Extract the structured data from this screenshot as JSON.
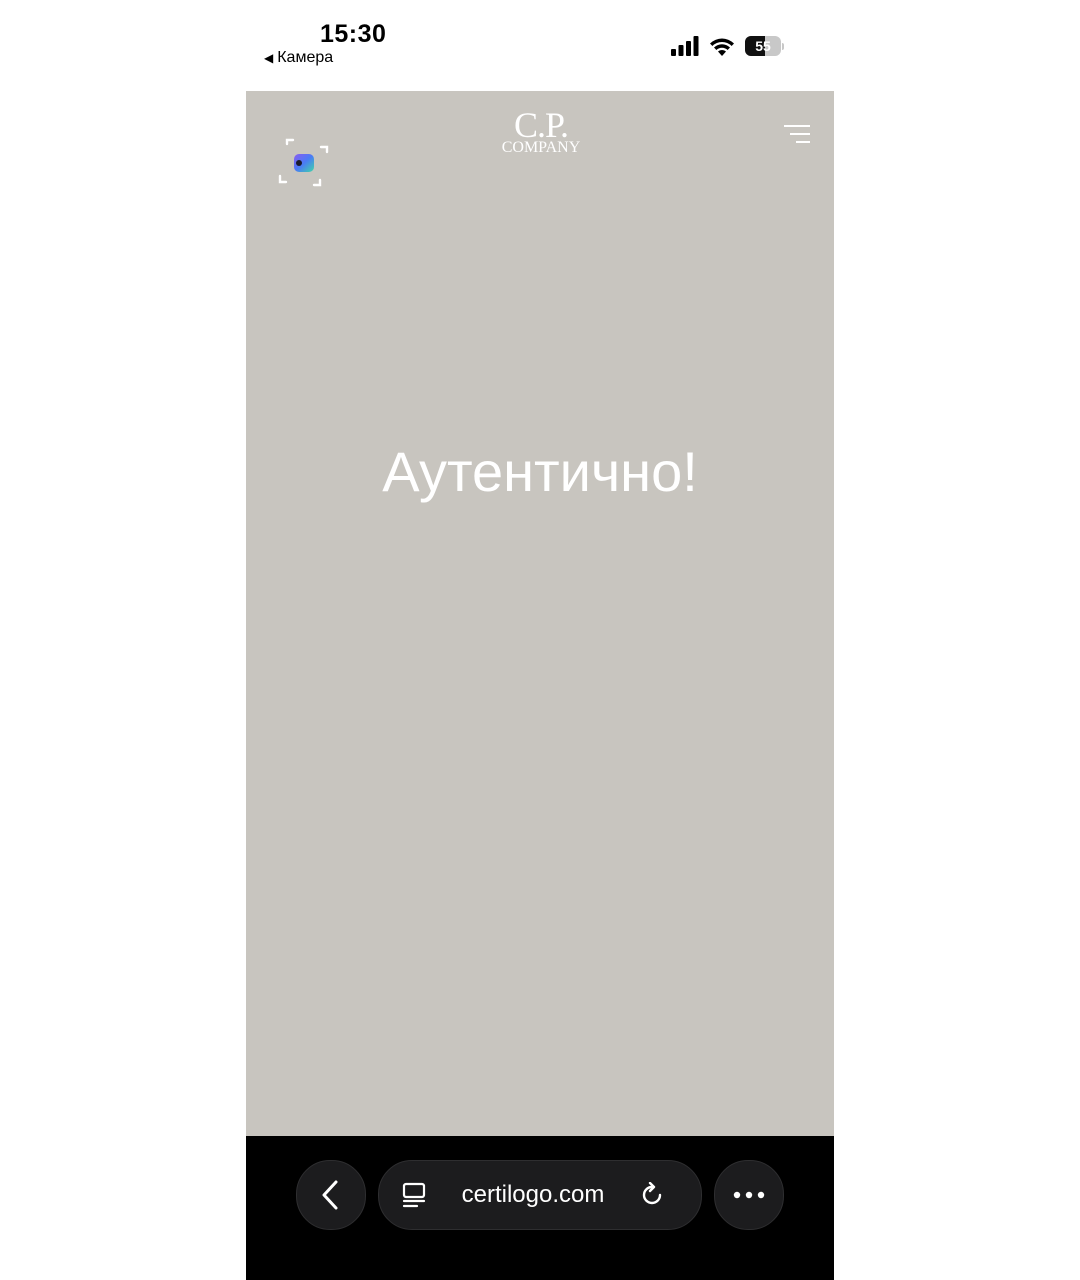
{
  "status_bar": {
    "time": "15:30",
    "back_app_label": "Камера",
    "battery_level": "55",
    "battery_fraction": 0.55,
    "signal_icon": "cellular-signal-icon",
    "wifi_icon": "wifi-icon"
  },
  "page": {
    "background_color": "#c8c5bf",
    "scan_icon": "scan-camera-icon",
    "logo": {
      "line1": "C.P.",
      "line2": "COMPANY"
    },
    "menu_icon": "hamburger-menu-icon",
    "headline": "Аутентично!"
  },
  "browser_toolbar": {
    "back_icon": "chevron-left-icon",
    "tabs_icon": "tabs-icon",
    "url": "certilogo.com",
    "reload_icon": "reload-icon",
    "more_icon": "more-dots-icon"
  }
}
